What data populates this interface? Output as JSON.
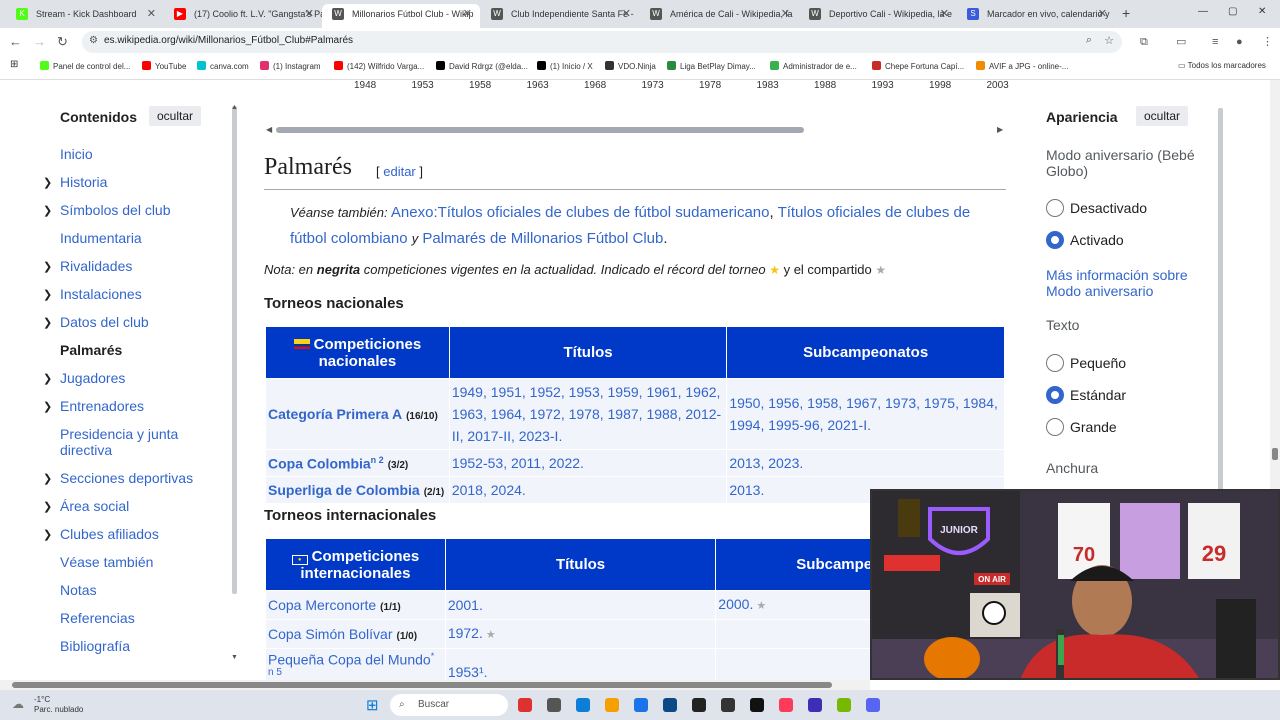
{
  "tabs": [
    {
      "label": "Stream - Kick Dashboard",
      "color": "#53fc18",
      "glyph": "K"
    },
    {
      "label": "(17) Coolio ft. L.V. \"Gangsta's Pa",
      "color": "#ff0000",
      "glyph": "▶"
    },
    {
      "label": "Millonarios Fútbol Club - Wikip",
      "color": "#555",
      "glyph": "W"
    },
    {
      "label": "Club Independiente Santa Fe -",
      "color": "#555",
      "glyph": "W"
    },
    {
      "label": "América de Cali - Wikipedia, la",
      "color": "#555",
      "glyph": "W"
    },
    {
      "label": "Deportivo Cali - Wikipedia, la e",
      "color": "#555",
      "glyph": "W"
    },
    {
      "label": "Marcador en vivo, calendario y",
      "color": "#3b5bdb",
      "glyph": "S"
    }
  ],
  "url": "es.wikipedia.org/wiki/Millonarios_Fútbol_Club#Palmarés",
  "bookmarks": [
    {
      "label": "Panel de control del...",
      "color": "#53fc18"
    },
    {
      "label": "YouTube",
      "color": "#ff0000"
    },
    {
      "label": "canva.com",
      "color": "#00c4cc"
    },
    {
      "label": "(1) Instagram",
      "color": "#e1306c"
    },
    {
      "label": "(142) Wilfrido Varga...",
      "color": "#ff0000"
    },
    {
      "label": "David Rdrgz (@elda...",
      "color": "#000000"
    },
    {
      "label": "(1) Inicio / X",
      "color": "#000000"
    },
    {
      "label": "VDO.Ninja",
      "color": "#333333"
    },
    {
      "label": "Liga BetPlay Dimay...",
      "color": "#2b8a3e"
    },
    {
      "label": "Administrador de e...",
      "color": "#37b24d"
    },
    {
      "label": "Chepe Fortuna Capí...",
      "color": "#c92a2a"
    },
    {
      "label": "AVIF a JPG - online-...",
      "color": "#f08c00"
    }
  ],
  "bookmarks_all": "Todos los marcadores",
  "timeline_years": [
    "1948",
    "1953",
    "1958",
    "1963",
    "1968",
    "1973",
    "1978",
    "1983",
    "1988",
    "1993",
    "1998",
    "2003"
  ],
  "toc": {
    "title": "Contenidos",
    "hide": "ocultar",
    "items": [
      {
        "label": "Inicio",
        "chev": false,
        "bold": false
      },
      {
        "label": "Historia",
        "chev": true,
        "bold": false
      },
      {
        "label": "Símbolos del club",
        "chev": true,
        "bold": false
      },
      {
        "label": "Indumentaria",
        "chev": false,
        "bold": false
      },
      {
        "label": "Rivalidades",
        "chev": true,
        "bold": false
      },
      {
        "label": "Instalaciones",
        "chev": true,
        "bold": false
      },
      {
        "label": "Datos del club",
        "chev": true,
        "bold": false
      },
      {
        "label": "Palmarés",
        "chev": false,
        "bold": true
      },
      {
        "label": "Jugadores",
        "chev": true,
        "bold": false
      },
      {
        "label": "Entrenadores",
        "chev": true,
        "bold": false
      },
      {
        "label": "Presidencia y junta directiva",
        "chev": false,
        "bold": false
      },
      {
        "label": "Secciones deportivas",
        "chev": true,
        "bold": false
      },
      {
        "label": "Área social",
        "chev": true,
        "bold": false
      },
      {
        "label": "Clubes afiliados",
        "chev": true,
        "bold": false
      },
      {
        "label": "Véase también",
        "chev": false,
        "bold": false
      },
      {
        "label": "Notas",
        "chev": false,
        "bold": false
      },
      {
        "label": "Referencias",
        "chev": false,
        "bold": false
      },
      {
        "label": "Bibliografía",
        "chev": false,
        "bold": false
      }
    ]
  },
  "section": {
    "title": "Palmarés",
    "edit": "editar"
  },
  "seealso": {
    "prefix": "Véanse también:",
    "link1": "Anexo:Títulos oficiales de clubes de fútbol sudamericano",
    "link2": "Títulos oficiales de clubes de fútbol colombiano",
    "y": "y",
    "link3": "Palmarés de Millonarios Fútbol Club"
  },
  "note": {
    "a": "Nota: en",
    "bold": "negrita",
    "b": "competiciones vigentes en la actualidad. Indicado el récord del torneo",
    "c": "y el compartido"
  },
  "nacionales": {
    "heading": "Torneos nacionales",
    "headers": [
      "Competiciones nacionales",
      "Títulos",
      "Subcampeonatos"
    ],
    "rows": [
      {
        "name": "Categoría Primera A",
        "count": "(16/10)",
        "titles": "1949, 1951, 1952, 1953, 1959, 1961, 1962, 1963, 1964, 1972, 1978, 1987, 1988, 2012-II, 2017-II, 2023-I.",
        "sub": "1950, 1956, 1958, 1967, 1973, 1975, 1984, 1994, 1995-96, 2021-I."
      },
      {
        "name": "Copa Colombia",
        "sup": "n 2",
        "count": "(3/2)",
        "titles": "1952-53, 2011, 2022.",
        "sub": "2013, 2023."
      },
      {
        "name": "Superliga de Colombia",
        "count": "(2/1)",
        "titles": "2018, 2024.",
        "sub": "2013."
      }
    ]
  },
  "internacionales": {
    "heading": "Torneos internacionales",
    "headers": [
      "Competiciones internacionales",
      "Títulos",
      "Subcampe"
    ],
    "rows": [
      {
        "name": "Copa Merconorte",
        "count": "(1/1)",
        "titles": "2001.",
        "sub": "2000."
      },
      {
        "name": "Copa Simón Bolívar",
        "count": "(1/0)",
        "titles": "1972.",
        "sub": ""
      },
      {
        "name": "Pequeña Copa del Mundo",
        "sup": "*",
        "extra": "n 5",
        "count": "(1/0)",
        "titles": "1953¹.",
        "sub": ""
      }
    ]
  },
  "apariencia": {
    "title": "Apariencia",
    "hide": "ocultar",
    "modo_label": "Modo aniversario (Bebé Globo)",
    "modo_options": [
      "Desactivado",
      "Activado"
    ],
    "modo_selected": "Activado",
    "more": "Más información sobre Modo aniversario",
    "texto_label": "Texto",
    "texto_options": [
      "Pequeño",
      "Estándar",
      "Grande"
    ],
    "texto_selected": "Estándar",
    "anchura_label": "Anchura"
  },
  "webcam": {
    "onair": "ON AIR",
    "team": "JUNIOR",
    "jersey_left": "70",
    "jersey_right": "29"
  },
  "taskbar": {
    "search": "Buscar",
    "temp": "-1°C",
    "weather": "Parc. nublado"
  }
}
